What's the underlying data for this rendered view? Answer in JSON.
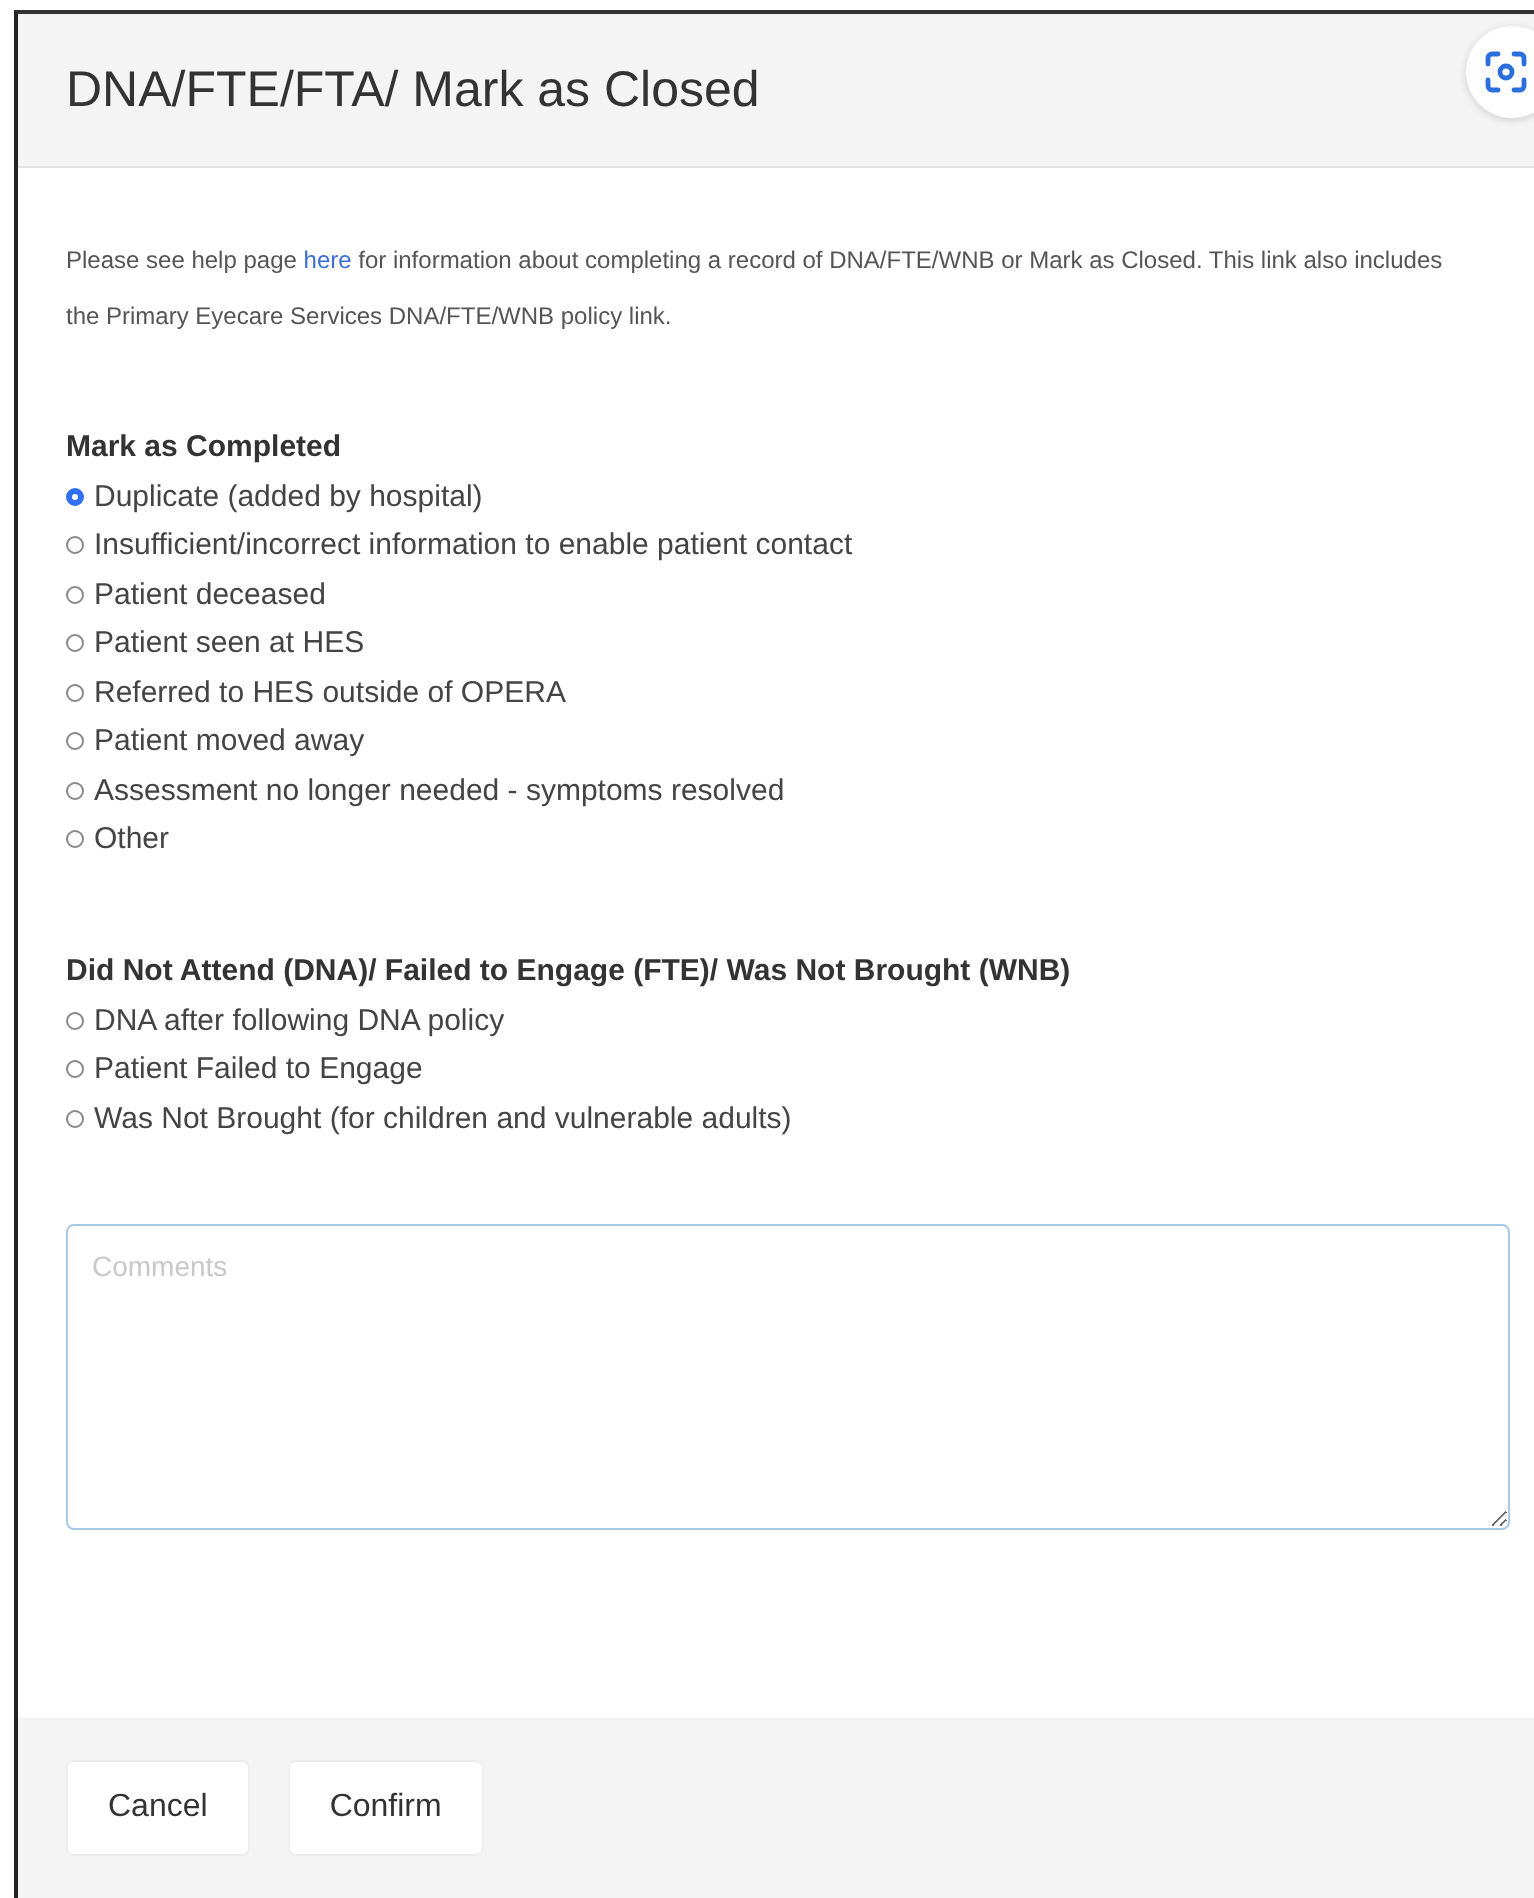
{
  "dialog": {
    "title": "DNA/FTE/FTA/ Mark as Closed"
  },
  "help": {
    "before": "Please see help page ",
    "link": "here",
    "after": " for information about completing a record of DNA/FTE/WNB or Mark as Closed. This link also includes the Primary Eyecare Services DNA/FTE/WNB policy link."
  },
  "groups": [
    {
      "heading": "Mark as Completed",
      "options": [
        {
          "label": "Duplicate (added by hospital)",
          "selected": true
        },
        {
          "label": "Insufficient/incorrect information to enable patient contact",
          "selected": false
        },
        {
          "label": "Patient deceased",
          "selected": false
        },
        {
          "label": "Patient seen at HES",
          "selected": false
        },
        {
          "label": "Referred to HES outside of OPERA",
          "selected": false
        },
        {
          "label": "Patient moved away",
          "selected": false
        },
        {
          "label": "Assessment no longer needed - symptoms resolved",
          "selected": false
        },
        {
          "label": "Other",
          "selected": false
        }
      ]
    },
    {
      "heading": "Did Not Attend (DNA)/ Failed to Engage (FTE)/ Was Not Brought (WNB)",
      "options": [
        {
          "label": "DNA after following DNA policy",
          "selected": false
        },
        {
          "label": "Patient Failed to Engage",
          "selected": false
        },
        {
          "label": "Was Not Brought (for children and vulnerable adults)",
          "selected": false
        }
      ]
    }
  ],
  "comments": {
    "placeholder": "Comments"
  },
  "buttons": [
    "Cancel",
    "Confirm"
  ]
}
